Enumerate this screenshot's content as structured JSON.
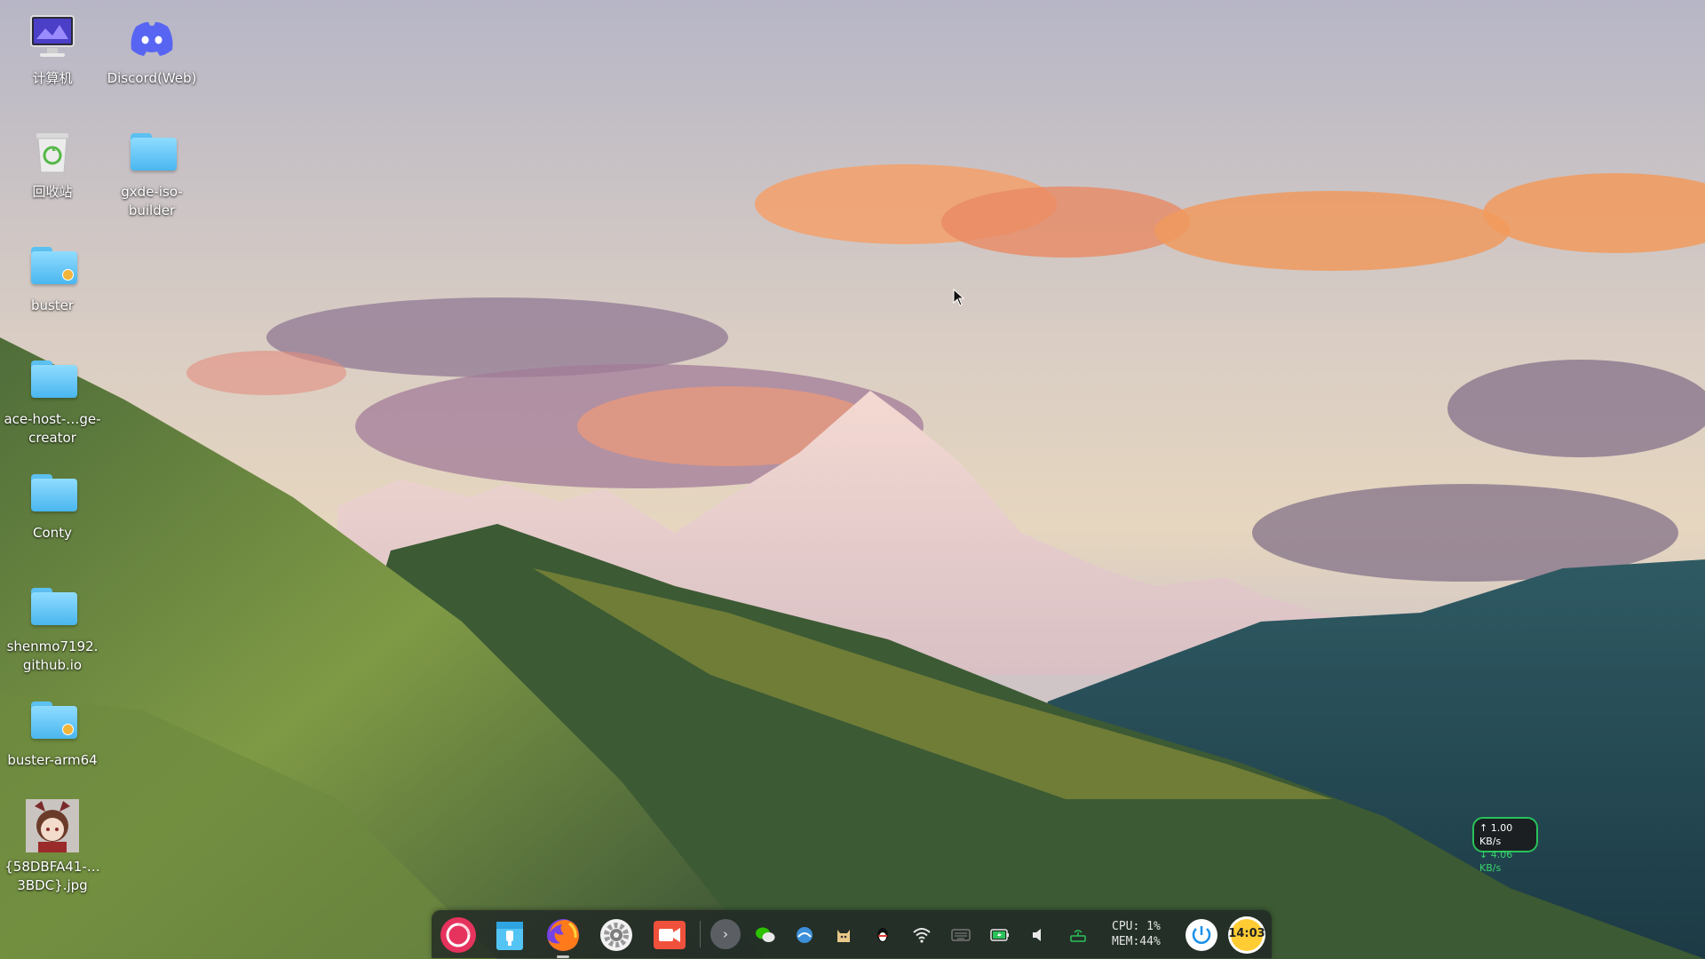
{
  "desktop": {
    "icons": [
      {
        "label": "计算机",
        "icon": "computer-icon"
      },
      {
        "label": "Discord(Web)",
        "icon": "discord-icon"
      },
      {
        "label": "回收站",
        "icon": "trash-icon"
      },
      {
        "label": "gxde-iso-builder",
        "icon": "folder-icon"
      },
      {
        "label": "buster",
        "icon": "folder-locked-icon"
      },
      {
        "label": "ace-host-…ge-creator",
        "icon": "folder-icon"
      },
      {
        "label": "Conty",
        "icon": "folder-icon"
      },
      {
        "label": "shenmo7192.github.io",
        "icon": "folder-icon"
      },
      {
        "label": "buster-arm64",
        "icon": "folder-locked-icon"
      },
      {
        "label": "{58DBFA41-…3BDC}.jpg",
        "icon": "image-thumbnail-icon"
      }
    ]
  },
  "dock": {
    "apps": [
      {
        "name": "launcher",
        "icon": "launcher-icon"
      },
      {
        "name": "file-manager",
        "icon": "file-manager-icon"
      },
      {
        "name": "firefox",
        "icon": "firefox-icon"
      },
      {
        "name": "settings",
        "icon": "settings-gear-icon"
      },
      {
        "name": "screen-recorder",
        "icon": "camera-icon"
      }
    ],
    "tray": [
      "expand-icon",
      "wechat-icon",
      "network-drive-icon",
      "cat-icon",
      "qq-penguin-icon",
      "wifi-icon",
      "keyboard-icon",
      "battery-icon",
      "volume-icon",
      "router-icon"
    ],
    "cpu_label": "CPU: 1%",
    "mem_label": "MEM:44%",
    "clock": "14:03"
  },
  "netspeed": {
    "up": "↑ 1.00 KB/s",
    "down": "↓ 4.06 KB/s"
  },
  "colors": {
    "folder": "#6cc7f5",
    "dock_bg": "#1e2224",
    "net_border": "#29c25a",
    "discord": "#5865f2"
  }
}
